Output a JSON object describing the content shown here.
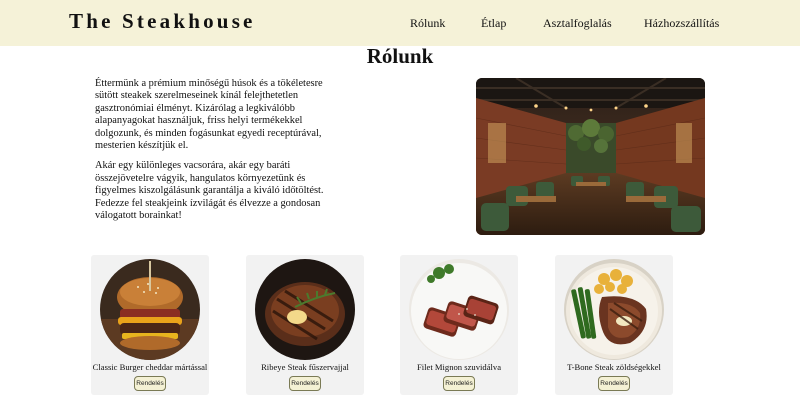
{
  "brand": "The Steakhouse",
  "nav": [
    "Rólunk",
    "Étlap",
    "Asztalfoglalás",
    "Házhozszállítás"
  ],
  "section_title": "Rólunk",
  "about": {
    "paragraph1": "Éttermünk a prémium minőségű húsok és a tökéletesre sütött steakek szerelmeseinek kínál felejthetetlen gasztronómiai élményt. Kizárólag a legkiválóbb alapanyagokat használjuk, friss helyi termékekkel dolgozunk, és minden fogásunkat egyedi receptúrával, mesterien készítjük el.",
    "paragraph2": "Akár egy különleges vacsorára, akár egy baráti összejövetelre vágyik, hangulatos környezetünk és figyelmes kiszolgálásunk garantálja a kiváló időtöltést. Fedezze fel steakjeink ízvilágát és élvezze a gondosan válogatott borainkat!"
  },
  "menu_cards": [
    {
      "name": "Classic Burger cheddar mártással",
      "button": "Rendelés"
    },
    {
      "name": "Ribeye Steak fűszervajjal",
      "button": "Rendelés"
    },
    {
      "name": "Filet Mignon szuvidálva",
      "button": "Rendelés"
    },
    {
      "name": "T-Bone Steak zöldségekkel",
      "button": "Rendelés"
    }
  ]
}
